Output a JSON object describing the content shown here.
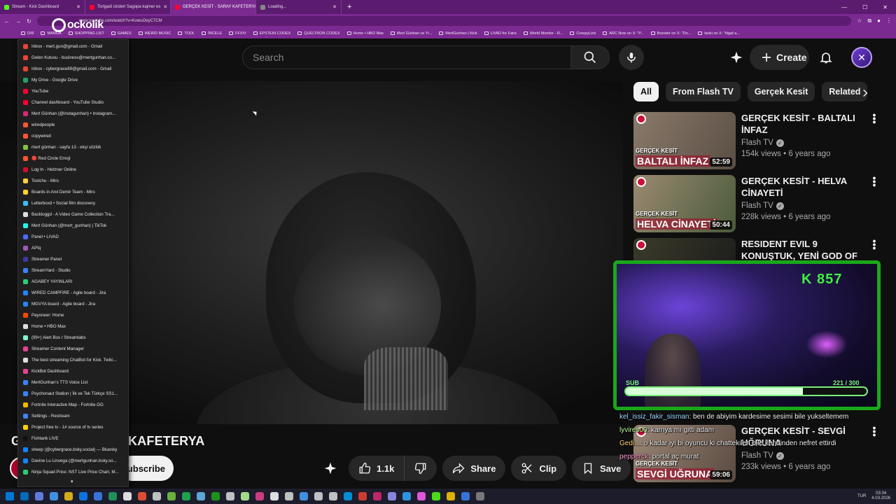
{
  "browser": {
    "tabs": [
      {
        "title": "Stream - Kick Dashboard",
        "color": "#53fc18",
        "active": false
      },
      {
        "title": "Torigadi cinderi Sagopa kajmer es",
        "color": "#ff0033",
        "active": false
      },
      {
        "title": "GERÇEK KESİT - SARAY KAFETERYA",
        "color": "#ff0033",
        "active": true
      },
      {
        "title": "Loading...",
        "color": "#888888",
        "active": false
      }
    ],
    "new_tab": "+",
    "url": "www.youtube.com/watch?v=KowuOeyC7CM",
    "bookmarks": [
      "DIR",
      "MANGA",
      "SHOPPING LIST",
      "GAMES",
      "WEIRD MUSIC",
      "TOOL",
      "İNCELE",
      "FFXIV",
      "EPSTEIN CODEX",
      "QUELTRON CODEX",
      "Home • HBO Max",
      "Mert Günhan ve Yi...",
      "MertGunhan | Kick",
      "LIVAD for Fans",
      "World Monitor - R...",
      "CreepyLink",
      "ARC Now on X: \"P...",
      "Booster on X: \"Do...",
      "taoki on X: \"ölgaf a..."
    ],
    "overlay_logo": "ockolik"
  },
  "bookmark_menu": {
    "items": [
      {
        "label": "Inbox - mert.gun@gmail.com - Gmail",
        "color": "#ea4335"
      },
      {
        "label": "Gelen Kutusu - business@mertgunhan.co...",
        "color": "#ea4335"
      },
      {
        "label": "Inbox - cybergrace89@gmail.com - Gmail",
        "color": "#ea4335"
      },
      {
        "label": "My Drive - Google Drive",
        "color": "#1fa463"
      },
      {
        "label": "YouTube",
        "color": "#ff0033"
      },
      {
        "label": "Channel dashboard - YouTube Studio",
        "color": "#ff0033"
      },
      {
        "label": "Mert Günhan (@instagunhan) • Instagram...",
        "color": "#d62976"
      },
      {
        "label": "wiredpeople",
        "color": "#ff5533"
      },
      {
        "label": "copywired",
        "color": "#ff5533"
      },
      {
        "label": "mert günhan - sayfa 13 - ekşi sözlük",
        "color": "#81c14b"
      },
      {
        "label": "🔴 Red Circle Emoji",
        "color": "#ff5533"
      },
      {
        "label": "Log In - Hetzner Online",
        "color": "#d50c2d"
      },
      {
        "label": "Tostchu - Miro",
        "color": "#ffd02f"
      },
      {
        "label": "Boards in Anıl Demir Team - Miro",
        "color": "#ffd02f"
      },
      {
        "label": "Letterboxd • Social film discovery.",
        "color": "#40bcf4"
      },
      {
        "label": "Backloggd - A Video Game Collection Tra...",
        "color": "#dddddd"
      },
      {
        "label": "Mert Günhan (@mert_gunhan) | TikTok",
        "color": "#25f4ee"
      },
      {
        "label": "Panel • LIVAD",
        "color": "#4a6cf7"
      },
      {
        "label": "APIq",
        "color": "#9b59b6"
      },
      {
        "label": "Streamer Panel",
        "color": "#3a3aa0"
      },
      {
        "label": "StreamYard - Studio",
        "color": "#3b82f6"
      },
      {
        "label": "AGABEY YAYINLARI",
        "color": "#2ecc71"
      },
      {
        "label": "WIRED CAMPFIRE - Agile board - Jira",
        "color": "#2684ff"
      },
      {
        "label": "MGVYA board - Agile board - Jira",
        "color": "#2684ff"
      },
      {
        "label": "Payoneer: Home",
        "color": "#ff4800"
      },
      {
        "label": "Home • HBO Max",
        "color": "#dddddd"
      },
      {
        "label": "(99+) Alert Box / Streamlabs",
        "color": "#80f5d2"
      },
      {
        "label": "Streamer Content Manager",
        "color": "#e84393"
      },
      {
        "label": "The best streaming ChatBot for Kick. Twitc...",
        "color": "#dddddd"
      },
      {
        "label": "KickBot Dashboard",
        "color": "#e84393"
      },
      {
        "label": "MertGunhan's TTS Voice List",
        "color": "#3b82f6"
      },
      {
        "label": "Psychonaut Station | İlk ve Tek Türkçe SS1...",
        "color": "#3b82f6"
      },
      {
        "label": "Fortnite Interactive Map - Fortnite.GG",
        "color": "#f5b700"
      },
      {
        "label": "Settings - Restream",
        "color": "#3b82f6"
      },
      {
        "label": "Project free tv - 1# source of tv series",
        "color": "#f5d300"
      },
      {
        "label": "Fishtank LIVE",
        "color": "#111111"
      },
      {
        "label": "sheep (@cybergrace.bsky.social) — Bluesky",
        "color": "#1185fe"
      },
      {
        "label": "Davine Lu Linvega (@mertgunhan.bsky.so...",
        "color": "#1185fe"
      },
      {
        "label": "Ninja Squad Price: NST Live Price Chart, M...",
        "color": "#2ecc71"
      }
    ],
    "more": "▾"
  },
  "youtube": {
    "search": {
      "placeholder": "Search"
    },
    "create_label": "Create",
    "video": {
      "title": "GERÇEK KESİT - SARAY KAFETERYA",
      "visible_title": "G                        AY KAFETERYA",
      "subscribe_label": "Subscribe",
      "like_count": "1.1k",
      "share_label": "Share",
      "clip_label": "Clip",
      "save_label": "Save"
    },
    "chips": [
      {
        "label": "All",
        "active": true
      },
      {
        "label": "From Flash TV",
        "active": false
      },
      {
        "label": "Gerçek Kesit",
        "active": false
      },
      {
        "label": "Related",
        "active": false
      }
    ],
    "recommendations": [
      {
        "title": "GERÇEK KESİT - BALTALI İNFAZ",
        "channel": "Flash TV",
        "views": "154k views",
        "age": "6 years ago",
        "duration": "52:59",
        "cap1": "GERÇEK KESİT",
        "cap2": "BALTALI İNFAZ",
        "bg1": "#8a7a6a",
        "bg2": "#5a4e44"
      },
      {
        "title": "GERÇEK KESİT - HELVA CİNAYETİ",
        "channel": "Flash TV",
        "views": "228k views",
        "age": "6 years ago",
        "duration": "50:44",
        "cap1": "GERÇEK KESİT",
        "cap2": "HELVA CİNAYETİ",
        "bg1": "#9a8a72",
        "bg2": "#4a5a3a"
      },
      {
        "title": "RESIDENT EVIL 9 KONUŞTUK, YENİ GOD OF WA...",
        "channel": "",
        "views": "",
        "age": "",
        "duration": "",
        "cap1": "",
        "cap2": "RESIDENT EVIL 9",
        "bg1": "#3a3a2a",
        "bg2": "#1a1a1a"
      },
      {
        "title": "GERÇEK KESİT - SEVGİ UĞRUNA",
        "channel": "Flash TV",
        "views": "233k views",
        "age": "6 years ago",
        "duration": "59:06",
        "cap1": "GERÇEK KESİT",
        "cap2": "SEVGİ UĞRUNA",
        "bg1": "#9a8676",
        "bg2": "#5a4a40"
      }
    ]
  },
  "stream_overlay": {
    "kick_count": "K 857",
    "sub_label": "SUB",
    "sub_progress_text": "221 / 300",
    "sub_progress": 0.7367,
    "chat": [
      {
        "user": "kel_issiz_fakir_sisman",
        "text": ": ben de abiyim kardesime sesimi bile yukseltemem",
        "cls": "u1"
      },
      {
        "user": "lyvires00",
        "text": ": karnya mı gitti adam",
        "cls": "u2"
      },
      {
        "user": "Gedi...",
        "text": ": o kadar iyi bi oyuncu ki chattekileri bile kendinden nefret ettirdi",
        "cls": "u3"
      },
      {
        "user": "pepperck",
        "text": ": portal aç murat",
        "cls": "u4"
      }
    ]
  },
  "taskbar": {
    "lang": "TUR",
    "time": "03:34",
    "date": "4.03.2026",
    "icons": [
      "#0078d4",
      "#0078d4",
      "#6b8aff",
      "#4aa3ff",
      "#f5c518",
      "#0a84ff",
      "#3b82f6",
      "#1fa463",
      "#ffffff",
      "#ff5533",
      "#dddddd",
      "#7ac943",
      "#1db954",
      "#66c0f4",
      "#1aa81a",
      "#dddddd",
      "#b9ff9a",
      "#e84393",
      "#ffffff",
      "#dddddd",
      "#4aa3ff",
      "#dddddd",
      "#dddddd",
      "#00a1f1",
      "#ea4335",
      "#d62976",
      "#9999ff",
      "#31a8ff",
      "#ff61f6",
      "#53fc18",
      "#ffcc00",
      "#3b82f6",
      "#888888"
    ]
  }
}
